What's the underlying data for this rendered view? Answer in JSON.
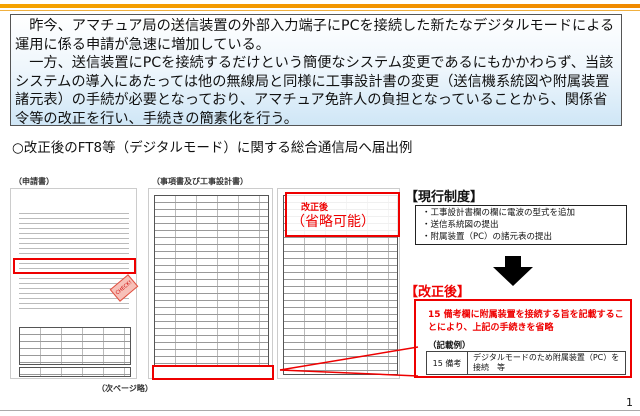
{
  "intro": {
    "p1": "昨今、アマチュア局の送信装置の外部入力端子にPCを接続した新たなデジタルモードによる運用に係る申請が急速に増加している。",
    "p2": "一方、送信装置にPCを接続するだけという簡便なシステム変更であるにもかかわらず、当該システムの導入にあたっては他の無線局と同様に工事設計書の変更（送信機系統図や附属装置諸元表）の手続が必要となっており、アマチュア免許人の負担となっていることから、関係省令等の改正を行い、手続きの簡素化を行う。"
  },
  "heading": "○改正後のFT8等（デジタルモード）に関する総合通信局へ届出例",
  "docs": {
    "application_label": "（申請書）",
    "matters_label": "（事項書及び工事設計書）",
    "next_page": "（次ページ略）",
    "check_label": "CHECK!",
    "after_label": "改正後",
    "omittable": "（省略可能）"
  },
  "current": {
    "title": "【現行制度】",
    "items": [
      "・工事設計書欄の欄に電波の型式を追加",
      "・送信系統図の提出",
      "・附属装置（PC）の諸元表の提出"
    ]
  },
  "revised": {
    "title": "【改正後】",
    "desc": "15 備考欄に附属装置を接続する旨を記載することにより、上記の手続きを省略",
    "example_label": "（記載例）",
    "row_head": "15 備考",
    "row_text": "デジタルモードのため附属装置（PC）を接続　等"
  },
  "page_number": "1"
}
